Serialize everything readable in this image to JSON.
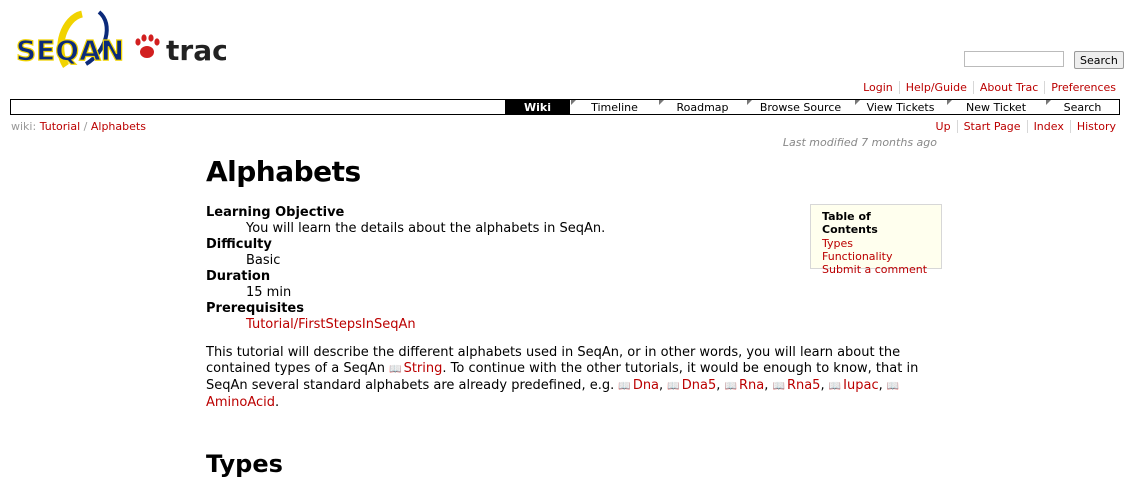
{
  "logo": {
    "brand": "SEQAN",
    "product": "trac",
    "brand_color": "#0b2a7a",
    "accent_color": "#f1d300",
    "paw_color": "#d21f1f"
  },
  "search": {
    "placeholder": "",
    "button_label": "Search"
  },
  "metanav": [
    "Login",
    "Help/Guide",
    "About Trac",
    "Preferences"
  ],
  "mainnav": {
    "active": "Wiki",
    "items": [
      "Wiki",
      "Timeline",
      "Roadmap",
      "Browse Source",
      "View Tickets",
      "New Ticket",
      "Search"
    ]
  },
  "breadcrumb": {
    "prefix": "wiki:",
    "parent": "Tutorial",
    "sep": "/",
    "current": "Alphabets"
  },
  "ctxtnav": [
    "Up",
    "Start Page",
    "Index",
    "History"
  ],
  "last_modified": "Last modified 7 months ago",
  "page": {
    "title": "Alphabets",
    "meta": [
      {
        "term": "Learning Objective",
        "value": "You will learn the details about the alphabets in SeqAn."
      },
      {
        "term": "Difficulty",
        "value": "Basic"
      },
      {
        "term": "Duration",
        "value": "15 min"
      },
      {
        "term": "Prerequisites",
        "value": "Tutorial/FirstStepsInSeqAn"
      }
    ],
    "intro": {
      "part1": "This tutorial will describe the different alphabets used in SeqAn, or in other words, you will learn about the contained types of a SeqAn ",
      "link_string": "String",
      "part2": ". To continue with the other tutorials, it would be enough to know, that in SeqAn several standard alphabets are already predefined, e.g. ",
      "links": [
        "Dna",
        "Dna5",
        "Rna",
        "Rna5",
        "Iupac",
        "AminoAcid"
      ],
      "sep": ", ",
      "end": "."
    },
    "section_heading": "Types"
  },
  "toc": {
    "title": "Table of Contents",
    "items": [
      "Types",
      "Functionality",
      "Submit a comment"
    ]
  }
}
